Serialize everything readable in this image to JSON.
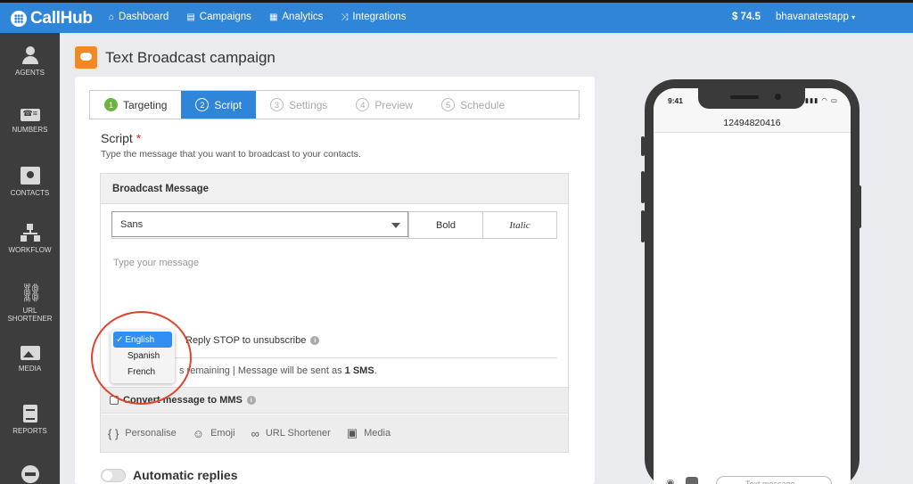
{
  "topbar": {
    "brand": "CallHub",
    "nav": [
      {
        "label": "Dashboard",
        "icon": "home-icon"
      },
      {
        "label": "Campaigns",
        "icon": "campaigns-icon"
      },
      {
        "label": "Analytics",
        "icon": "analytics-icon"
      },
      {
        "label": "Integrations",
        "icon": "integrations-icon"
      }
    ],
    "balance": "$ 74.5",
    "user": "bhavanatestapp"
  },
  "sidebar": {
    "items": [
      {
        "label": "AGENTS",
        "icon": "agents-icon"
      },
      {
        "label": "NUMBERS",
        "icon": "numbers-icon"
      },
      {
        "label": "CONTACTS",
        "icon": "contacts-icon"
      },
      {
        "label": "WORKFLOW",
        "icon": "workflow-icon"
      },
      {
        "label": "URL SHORTENER",
        "icon": "link-icon"
      },
      {
        "label": "MEDIA",
        "icon": "media-icon"
      },
      {
        "label": "REPORTS",
        "icon": "reports-icon"
      },
      {
        "label": "",
        "icon": "minus-circle-icon"
      }
    ]
  },
  "page": {
    "title": "Text Broadcast campaign"
  },
  "steps": [
    {
      "num": "1",
      "label": "Targeting",
      "state": "done"
    },
    {
      "num": "2",
      "label": "Script",
      "state": "active"
    },
    {
      "num": "3",
      "label": "Settings",
      "state": "pending"
    },
    {
      "num": "4",
      "label": "Preview",
      "state": "pending"
    },
    {
      "num": "5",
      "label": "Schedule",
      "state": "pending"
    }
  ],
  "script": {
    "label": "Script",
    "required_mark": "*",
    "help": "Type the message that you want to broadcast to your contacts."
  },
  "broadcast": {
    "header": "Broadcast Message",
    "font_selected": "Sans",
    "bold_label": "Bold",
    "italic_label": "Italic",
    "message_placeholder": "Type your message",
    "reply_text": "Reply STOP to unsubscribe",
    "count_prefix": "s remaining | Message will be sent as ",
    "count_sms": "1 SMS",
    "count_suffix": ".",
    "mms_label": "Convert message to MMS",
    "tools": [
      {
        "label": "Personalise",
        "icon": "braces-icon"
      },
      {
        "label": "Emoji",
        "icon": "emoji-icon"
      },
      {
        "label": "URL Shortener",
        "icon": "link-icon"
      },
      {
        "label": "Media",
        "icon": "image-icon"
      }
    ]
  },
  "language_menu": {
    "options": [
      "English",
      "Spanish",
      "French"
    ],
    "selected": "English",
    "check": "✓"
  },
  "auto_replies": {
    "label": "Automatic replies",
    "enabled": false
  },
  "phone": {
    "time": "9:41",
    "number": "12494820416",
    "input_placeholder": "Text message"
  },
  "colors": {
    "topbar": "#2f86d8",
    "sidebar": "#3d3d3d",
    "active_step": "#2f86d8",
    "done_step": "#6db33f",
    "title_icon": "#f08a24",
    "highlight": "#e0442c"
  }
}
